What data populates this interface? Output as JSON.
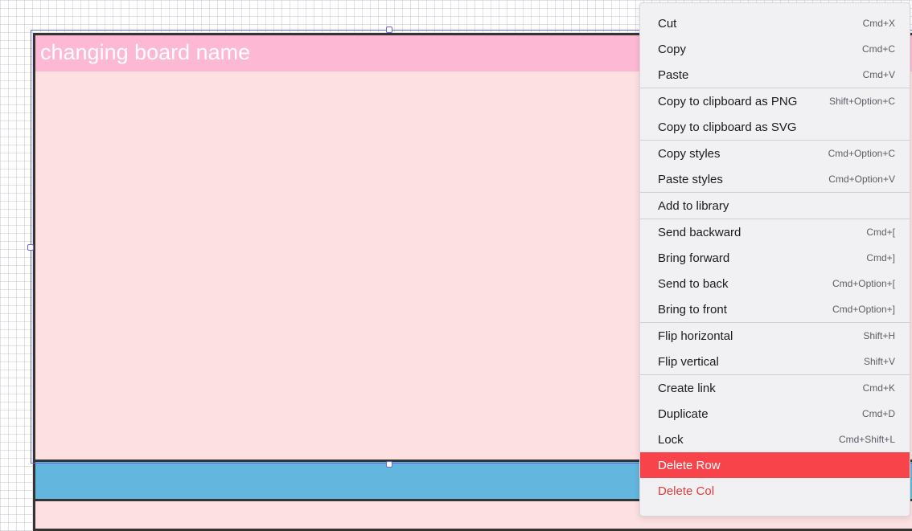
{
  "board": {
    "title": "changing board name",
    "colors": {
      "header": "#fdb9d3",
      "body": "#fde0e2",
      "row": "#63b6de",
      "border": "#343434",
      "selection": "#6965db"
    }
  },
  "context_menu": {
    "groups": [
      [
        {
          "label": "Cut",
          "shortcut": "Cmd+X"
        },
        {
          "label": "Copy",
          "shortcut": "Cmd+C"
        },
        {
          "label": "Paste",
          "shortcut": "Cmd+V"
        }
      ],
      [
        {
          "label": "Copy to clipboard as PNG",
          "shortcut": "Shift+Option+C"
        },
        {
          "label": "Copy to clipboard as SVG",
          "shortcut": ""
        }
      ],
      [
        {
          "label": "Copy styles",
          "shortcut": "Cmd+Option+C"
        },
        {
          "label": "Paste styles",
          "shortcut": "Cmd+Option+V"
        }
      ],
      [
        {
          "label": "Add to library",
          "shortcut": ""
        }
      ],
      [
        {
          "label": "Send backward",
          "shortcut": "Cmd+["
        },
        {
          "label": "Bring forward",
          "shortcut": "Cmd+]"
        },
        {
          "label": "Send to back",
          "shortcut": "Cmd+Option+["
        },
        {
          "label": "Bring to front",
          "shortcut": "Cmd+Option+]"
        }
      ],
      [
        {
          "label": "Flip horizontal",
          "shortcut": "Shift+H"
        },
        {
          "label": "Flip vertical",
          "shortcut": "Shift+V"
        }
      ],
      [
        {
          "label": "Create link",
          "shortcut": "Cmd+K"
        },
        {
          "label": "Duplicate",
          "shortcut": "Cmd+D"
        },
        {
          "label": "Lock",
          "shortcut": "Cmd+Shift+L"
        },
        {
          "label": "Delete Row",
          "shortcut": "",
          "style": "highlighted"
        },
        {
          "label": "Delete Col",
          "shortcut": "",
          "style": "danger"
        }
      ]
    ],
    "highlight_color": "#f8434b",
    "danger_color": "#e03c3c"
  }
}
